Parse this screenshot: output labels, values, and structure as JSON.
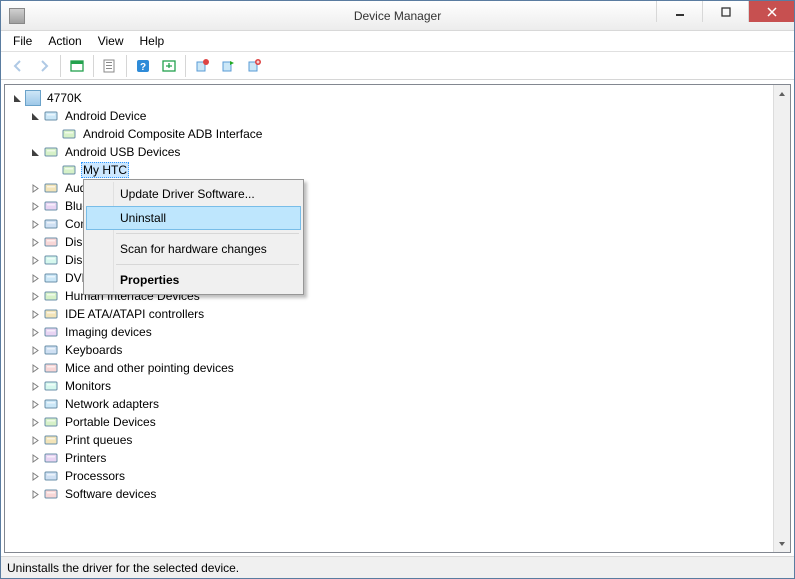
{
  "window": {
    "title": "Device Manager"
  },
  "menubar": [
    "File",
    "Action",
    "View",
    "Help"
  ],
  "toolbar_icons": [
    "back",
    "forward",
    "showhide",
    "properties",
    "help",
    "update",
    "uninstall",
    "scan",
    "addlegacy"
  ],
  "tree": {
    "root": "4770K",
    "nodes": [
      {
        "label": "Android Device",
        "expanded": true,
        "children": [
          {
            "label": "Android Composite ADB Interface"
          }
        ]
      },
      {
        "label": "Android USB Devices",
        "expanded": true,
        "children": [
          {
            "label": "My HTC",
            "selected": true
          }
        ]
      },
      {
        "label": "Audio inputs and outputs"
      },
      {
        "label": "Bluetooth"
      },
      {
        "label": "Computer"
      },
      {
        "label": "Disk drives"
      },
      {
        "label": "Display adapters"
      },
      {
        "label": "DVD/CD-ROM drives"
      },
      {
        "label": "Human Interface Devices"
      },
      {
        "label": "IDE ATA/ATAPI controllers"
      },
      {
        "label": "Imaging devices"
      },
      {
        "label": "Keyboards"
      },
      {
        "label": "Mice and other pointing devices"
      },
      {
        "label": "Monitors"
      },
      {
        "label": "Network adapters"
      },
      {
        "label": "Portable Devices"
      },
      {
        "label": "Print queues"
      },
      {
        "label": "Printers"
      },
      {
        "label": "Processors"
      },
      {
        "label": "Software devices"
      }
    ]
  },
  "context_menu": {
    "items": [
      {
        "label": "Update Driver Software..."
      },
      {
        "label": "Uninstall",
        "hover": true
      },
      {
        "sep": true
      },
      {
        "label": "Scan for hardware changes"
      },
      {
        "sep": true
      },
      {
        "label": "Properties",
        "bold": true
      }
    ]
  },
  "statusbar": "Uninstalls the driver for the selected device."
}
